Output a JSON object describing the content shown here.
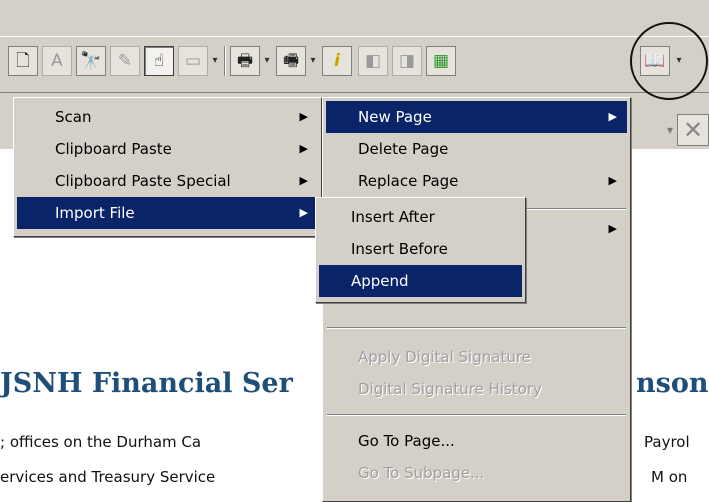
{
  "toolbar": {
    "icons": [
      "page-icon",
      "text-box-icon",
      "binoculars-icon",
      "ocr-icon",
      "hand-icon",
      "frame-icon",
      "print-icon",
      "scan-print-icon",
      "info-icon",
      "prev-page-icon",
      "next-page-icon",
      "color-icon",
      "book-page-icon"
    ],
    "glyphs": {
      "page": "🗋",
      "text": "A",
      "find": "🔭",
      "ocr": "✎",
      "hand": "☝",
      "frame": "▭",
      "print": "🖶",
      "print2": "🖷",
      "info": "i",
      "prev": "◧",
      "next": "◨",
      "color": "▦",
      "book": "📖",
      "drop": "▾",
      "close": "✕"
    }
  },
  "menu1": {
    "items": [
      {
        "label": "Scan",
        "submenu": true,
        "state": "normal"
      },
      {
        "label": "Clipboard Paste",
        "submenu": true,
        "state": "normal"
      },
      {
        "label": "Clipboard Paste Special",
        "submenu": true,
        "state": "normal"
      },
      {
        "label": "Import File",
        "submenu": true,
        "state": "selected"
      }
    ]
  },
  "menu2": {
    "items": [
      {
        "label": "New Page",
        "submenu": true,
        "state": "selected"
      },
      {
        "label": "Delete Page",
        "submenu": false,
        "state": "normal"
      },
      {
        "label": "Replace Page",
        "submenu": true,
        "state": "normal"
      },
      {
        "label": "Apply Digital Signature",
        "submenu": false,
        "state": "disabled"
      },
      {
        "label": "Digital Signature History",
        "submenu": false,
        "state": "disabled"
      },
      {
        "label": "Go To Page...",
        "submenu": false,
        "state": "normal"
      },
      {
        "label": "Go To Subpage...",
        "submenu": false,
        "state": "disabled"
      }
    ]
  },
  "menu3": {
    "items": [
      {
        "label": "Insert After",
        "state": "normal"
      },
      {
        "label": "Insert Before",
        "state": "normal"
      },
      {
        "label": "Append",
        "state": "selected"
      }
    ]
  },
  "document": {
    "heading_left": "JSNH Financial Ser",
    "heading_right": "nson",
    "line1_left": "; offices on the Durham Ca",
    "line1_right": "Payrol",
    "line2_left": "ervices and Treasury Service",
    "line2_right": "M on"
  },
  "colors": {
    "chrome": "#d4d0c8",
    "menu_highlight": "#0a246a",
    "heading": "#1f4e79"
  }
}
